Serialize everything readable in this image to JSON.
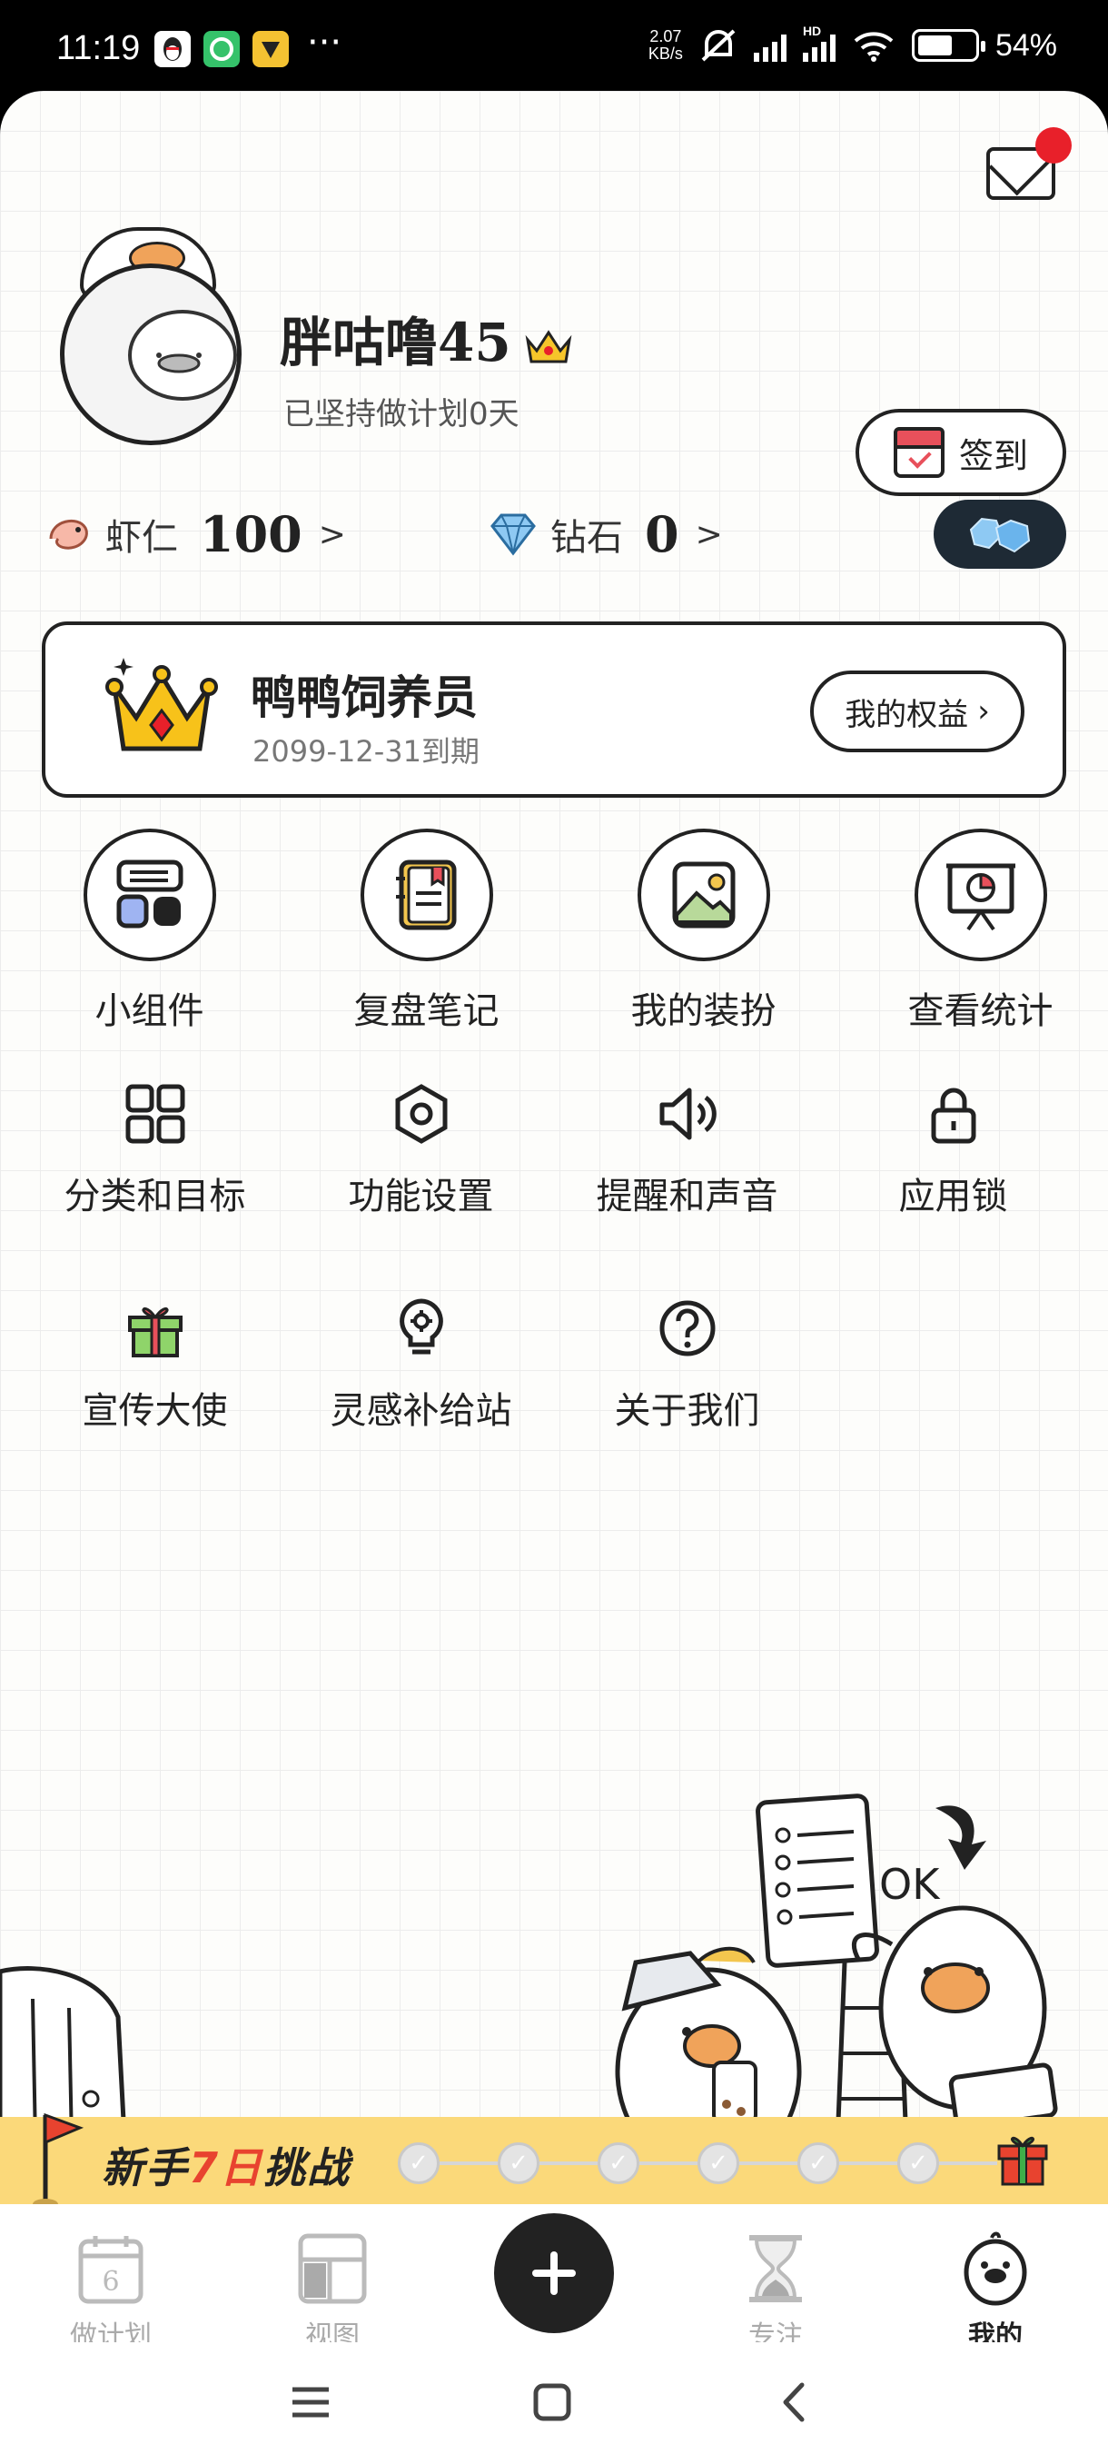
{
  "status_bar": {
    "time": "11:19",
    "dots": "···",
    "speed_value": "2.07",
    "speed_unit": "KB/s",
    "net_label": "HD",
    "battery_pct": "54%",
    "battery_level": 0.54
  },
  "profile": {
    "username": "胖咕噜45",
    "streak": "已坚持做计划0天",
    "checkin_label": "签到"
  },
  "currency": {
    "shrimp_label": "虾仁",
    "shrimp_value": "100",
    "diamond_label": "钻石",
    "diamond_value": "0",
    "arrow": ">"
  },
  "membership": {
    "title": "鸭鸭饲养员",
    "expire": "2099-12-31到期",
    "benefit_button": "我的权益"
  },
  "features": [
    {
      "label": "小组件",
      "icon": "widget-icon"
    },
    {
      "label": "复盘笔记",
      "icon": "notebook-icon"
    },
    {
      "label": "我的装扮",
      "icon": "picture-icon"
    },
    {
      "label": "查看统计",
      "icon": "chart-board-icon"
    }
  ],
  "tools": [
    {
      "label": "分类和目标",
      "icon": "grid-icon"
    },
    {
      "label": "功能设置",
      "icon": "hexagon-settings-icon"
    },
    {
      "label": "提醒和声音",
      "icon": "speaker-icon"
    },
    {
      "label": "应用锁",
      "icon": "lock-icon"
    },
    {
      "label": "宣传大使",
      "icon": "gift-icon"
    },
    {
      "label": "灵感补给站",
      "icon": "lightbulb-icon"
    },
    {
      "label": "关于我们",
      "icon": "question-icon"
    }
  ],
  "illustration": {
    "ok_text": "OK"
  },
  "challenge": {
    "title_prefix": "新手",
    "title_num": "7日",
    "title_suffix": "挑战",
    "steps_total": 6,
    "steps_done": 0
  },
  "nav": {
    "plan_day": "6",
    "plan": "做计划",
    "view": "视图",
    "focus": "专注",
    "mine": "我的",
    "active": "mine"
  },
  "colors": {
    "accent_dark": "#222222",
    "badge_red": "#e8202a",
    "banner_yellow": "#fbd97a",
    "challenge_red": "#e8432f"
  }
}
